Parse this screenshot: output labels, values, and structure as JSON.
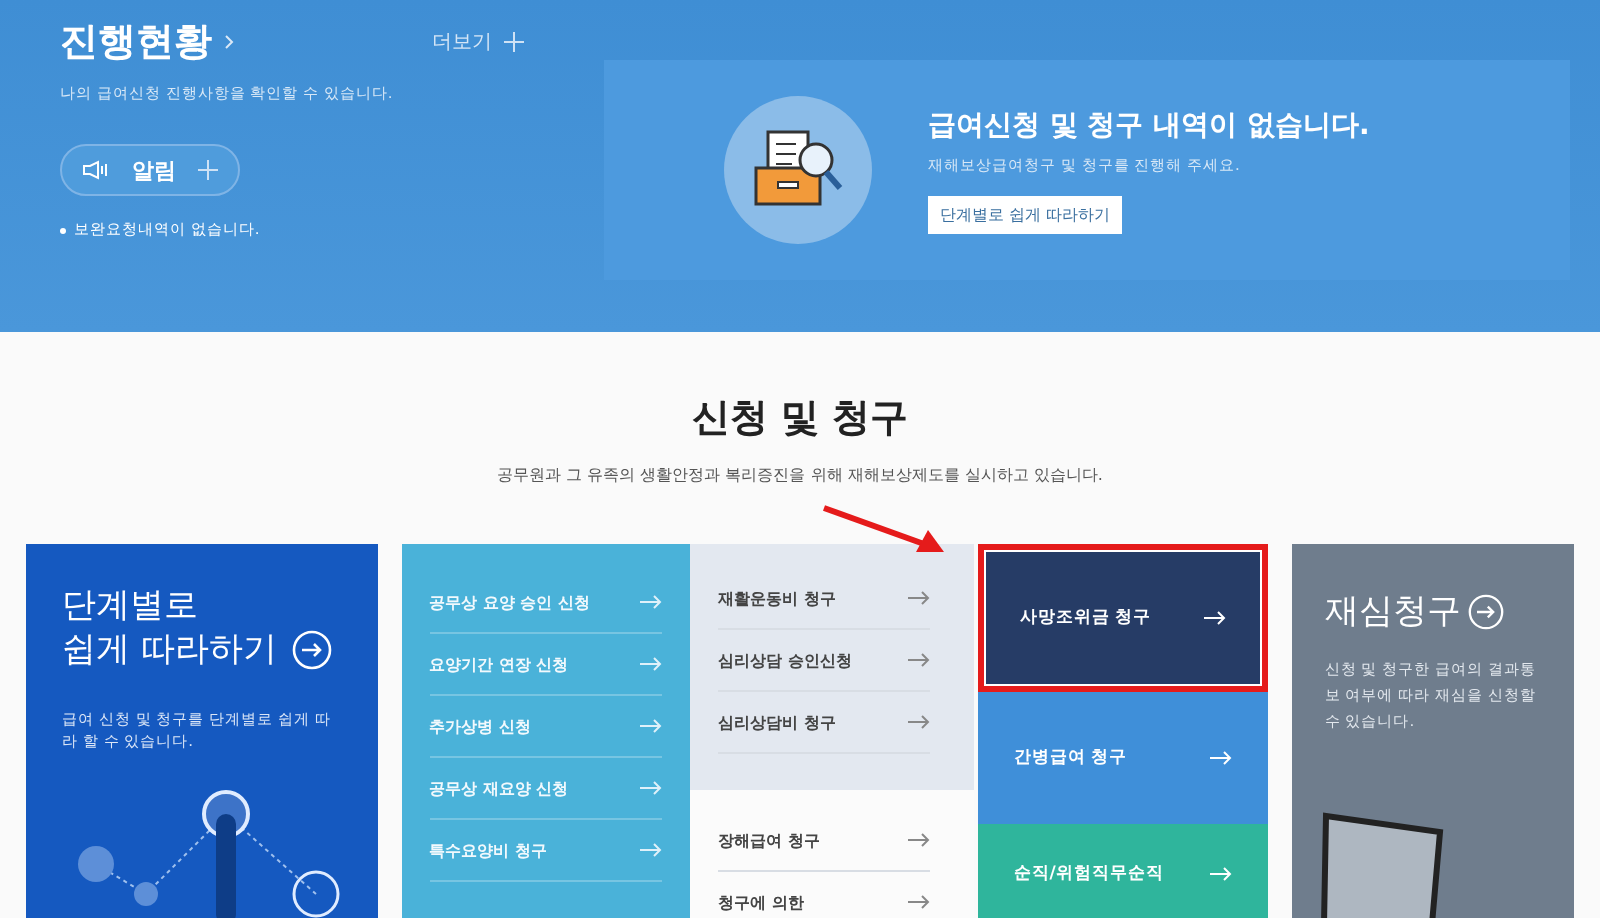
{
  "progress": {
    "title": "진행현황",
    "more": "더보기",
    "description": "나의 급여신청 진행사항을 확인할 수 있습니다.",
    "alarm_button": "알림",
    "notice": "보완요청내역이 없습니다."
  },
  "empty_state": {
    "title": "급여신청 및 청구 내역이 없습니다.",
    "description": "재해보상급여청구 및 청구를 진행해 주세요.",
    "button": "단계별로 쉽게 따라하기"
  },
  "section": {
    "title": "신청 및 청구",
    "description": "공무원과 그 유족의 생활안정과 복리증진을 위해 재해보상제도를 실시하고 있습니다."
  },
  "guide_card": {
    "title_lines": [
      "단계별로",
      "쉽게 따라하기"
    ],
    "description": "급여 신청 및 청구를 단계별로 쉽게 따라 할 수 있습니다."
  },
  "list_a": [
    "공무상 요양 승인 신청",
    "요양기간 연장 신청",
    "추가상병 신청",
    "공무상 재요양 신청",
    "특수요양비 청구"
  ],
  "list_b": [
    {
      "kind": "shaded",
      "items": [
        "재활운동비 청구",
        "심리상담 승인신청",
        "심리상담비 청구"
      ]
    },
    {
      "kind": "plain",
      "items": [
        "장해급여 청구",
        "청구에 의한"
      ]
    }
  ],
  "tiles": [
    {
      "label": "사망조위금 청구",
      "color": "#263c66",
      "highlighted": true
    },
    {
      "label": "간병급여 청구",
      "color": "#3f8fd9",
      "highlighted": false
    },
    {
      "label": "순직/위험직무순직",
      "color": "#2fb59c",
      "highlighted": false
    }
  ],
  "review_card": {
    "title": "재심청구",
    "description": "신청 및 청구한 급여의 결과통보 여부에 따라 재심을 신청할 수 있습니다."
  }
}
